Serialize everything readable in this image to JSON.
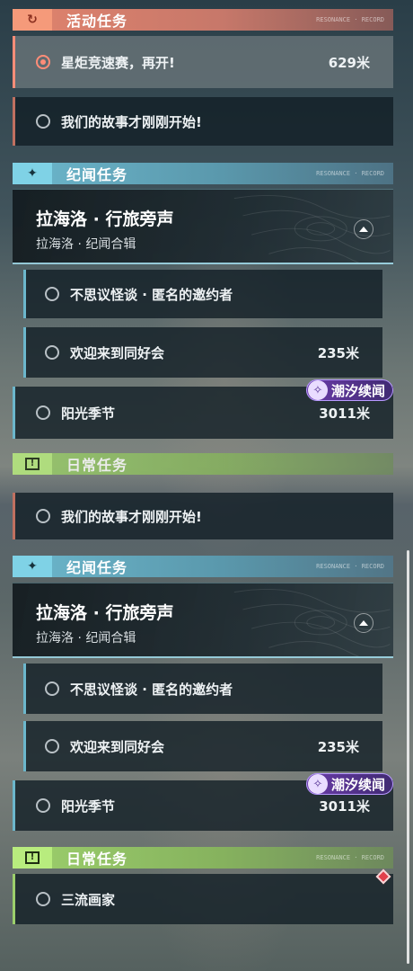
{
  "sections": {
    "event": {
      "title": "活动任务",
      "icon": "return-arrow-icon"
    },
    "lore": {
      "title": "纪闻任务",
      "icon": "sparkle-star-icon"
    },
    "daily": {
      "title": "日常任务",
      "icon": "exclamation-box-icon"
    }
  },
  "header_deco_text": "RESONANCE · RECORD",
  "top_view": {
    "event_quests": [
      {
        "name": "星炬竞速赛，再开!",
        "distance": "629米",
        "tracked": true
      },
      {
        "name": "我们的故事才刚刚开始!",
        "distance": "",
        "tracked": false
      }
    ],
    "region": {
      "title": "拉海洛 · 行旅旁声",
      "subtitle": "拉海洛 · 纪闻合辑"
    },
    "lore_quests": [
      {
        "name": "不思议怪谈 · 匿名的邀约者",
        "distance": ""
      },
      {
        "name": "欢迎来到同好会",
        "distance": "235米"
      },
      {
        "name": "阳光季节",
        "distance": "3011米"
      }
    ],
    "badge": "潮汐续闻",
    "daily_title": "日常任务"
  },
  "bottom_view": {
    "event_quest": {
      "name": "我们的故事才刚刚开始!"
    },
    "region": {
      "title": "拉海洛 · 行旅旁声",
      "subtitle": "拉海洛 · 纪闻合辑"
    },
    "lore_quests": [
      {
        "name": "不思议怪谈 · 匿名的邀约者",
        "distance": ""
      },
      {
        "name": "欢迎来到同好会",
        "distance": "235米"
      },
      {
        "name": "阳光季节",
        "distance": "3011米"
      }
    ],
    "badge": "潮汐续闻",
    "daily_quests": [
      {
        "name": "三流画家"
      }
    ]
  },
  "colors": {
    "event": "#e0836d",
    "lore": "#6cb7cc",
    "daily": "#9ccf6c",
    "badge": "#6a3ca8",
    "tracked": "#ff8d78"
  }
}
